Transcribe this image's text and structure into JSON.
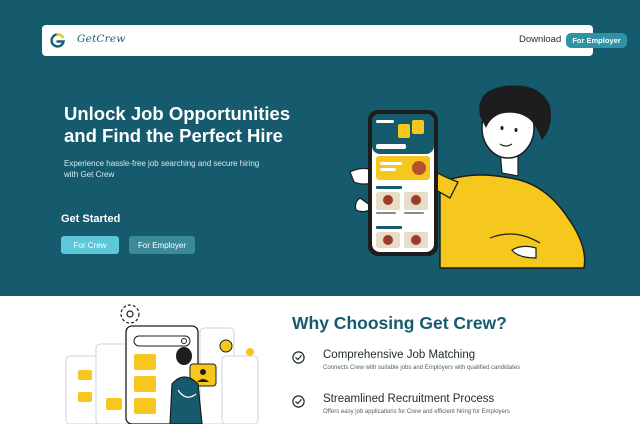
{
  "nav": {
    "logo_letter": "G",
    "logo_text": "GetCrew",
    "download": "Download",
    "for_employer": "For Employer"
  },
  "hero": {
    "title_line1": "Unlock Job Opportunities",
    "title_line2": "and Find the Perfect Hire",
    "subtitle_line1": "Experience hassle-free job searching and secure hiring",
    "subtitle_line2": "with Get Crew",
    "cta_title": "Get Started",
    "btn_crew": "For Crew",
    "btn_employer": "For Employer"
  },
  "why": {
    "title": "Why Choosing Get Crew?",
    "features": [
      {
        "title": "Comprehensive Job Matching",
        "desc": "Connects Crew with suitable jobs and Employers with qualified candidates"
      },
      {
        "title": "Streamlined Recruitment Process",
        "desc": "Offers easy job applications for Crew and efficient hiring for Employers"
      }
    ]
  },
  "colors": {
    "hero_bg": "#155a6d",
    "accent": "#2f93a6",
    "crew_button": "#5cc8da",
    "illustration_yellow": "#f6c71d"
  },
  "icons": [
    "check-circle-icon",
    "gear-icon",
    "search-icon",
    "user-icon",
    "image-icon"
  ]
}
